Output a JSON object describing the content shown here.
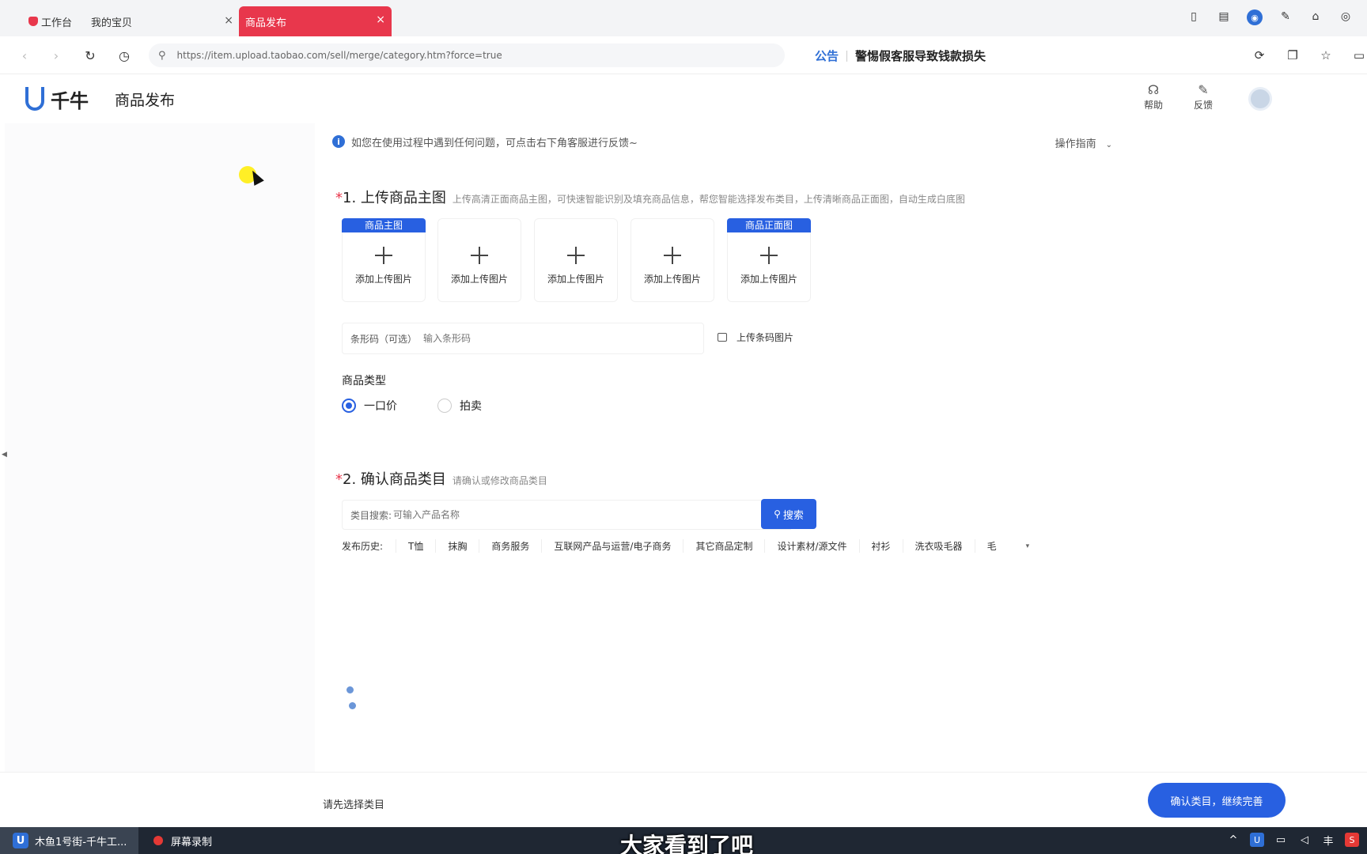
{
  "browser": {
    "tabs": [
      {
        "label": "工作台"
      },
      {
        "label": "我的宝贝"
      },
      {
        "label": "商品发布"
      }
    ],
    "tab_close_glyph": "×",
    "url": "https://item.upload.taobao.com/sell/merge/category.htm?force=true",
    "notice_label": "公告",
    "notice_text": "警惕假客服导致钱款损失"
  },
  "app": {
    "logo_text": "千牛",
    "page_title": "商品发布",
    "help_label": "帮助",
    "feedback_label": "反馈"
  },
  "info": {
    "text": "如您在使用过程中遇到任何问题，可点击右下角客服进行反馈~",
    "guide_label": "操作指南"
  },
  "section1": {
    "star": "*",
    "title": "1. 上传商品主图",
    "desc": "上传高清正面商品主图，可快速智能识别及填充商品信息，帮您智能选择发布类目，上传清晰商品正面图，自动生成白底图",
    "uploads": [
      {
        "tag": "商品主图",
        "label": "添加上传图片"
      },
      {
        "tag": "",
        "label": "添加上传图片"
      },
      {
        "tag": "",
        "label": "添加上传图片"
      },
      {
        "tag": "",
        "label": "添加上传图片"
      },
      {
        "tag": "商品正面图",
        "label": "添加上传图片"
      }
    ],
    "barcode_label": "条形码（可选）",
    "barcode_placeholder": "输入条形码",
    "barcode_upload_label": "上传条码图片",
    "type_label": "商品类型",
    "type_options": [
      {
        "label": "一口价",
        "checked": true
      },
      {
        "label": "拍卖",
        "checked": false
      }
    ]
  },
  "section2": {
    "star": "*",
    "title": "2. 确认商品类目",
    "desc": "请确认或修改商品类目",
    "search_label": "类目搜索:",
    "search_placeholder": "可输入产品名称",
    "search_button": "搜索",
    "history_label": "发布历史:",
    "history": [
      "T恤",
      "抹胸",
      "商务服务",
      "互联网产品与运营/电子商务",
      "其它商品定制",
      "设计素材/源文件",
      "衬衫",
      "洗衣吸毛器",
      "毛"
    ]
  },
  "footer": {
    "hint": "请先选择类目",
    "confirm_button": "确认类目，继续完善"
  },
  "taskbar": {
    "task1_label": "木鱼1号街-千牛工...",
    "task2_label": "屏幕录制",
    "subtitle": "大家看到了吧"
  },
  "colors": {
    "accent": "#2860e1",
    "tab_active": "#e8374c"
  }
}
